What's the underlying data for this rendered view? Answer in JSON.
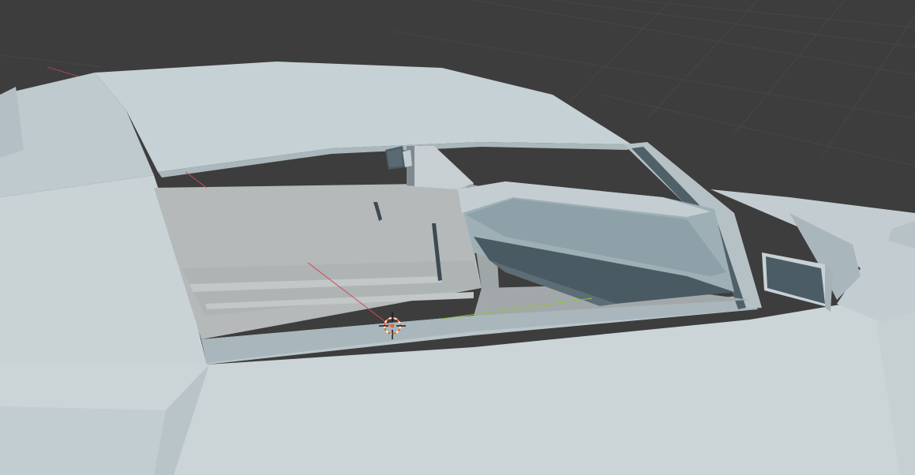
{
  "viewport": {
    "mode": "solid-shading",
    "background_color": "#3d3d3d",
    "grid_color": "#474747",
    "body_color": "#c8d3d6",
    "body_shadow_color": "#9fadb2",
    "interior_color": "#b4b9ba",
    "dark_trim_color": "#4a5a63",
    "axis_x_color": "#d04a55",
    "axis_y_color": "#8fc23f",
    "cursor_colors": [
      "#e06a2a",
      "#ffffff",
      "#1a1a1a"
    ]
  },
  "objects": {
    "car_body": "car-body",
    "side_mirror": "side-mirror",
    "rear_view_mirror": "rear-view-mirror",
    "dashboard": "dashboard",
    "a_pillar": "a-pillar"
  },
  "tools": {
    "cursor": "3d-cursor-icon"
  }
}
